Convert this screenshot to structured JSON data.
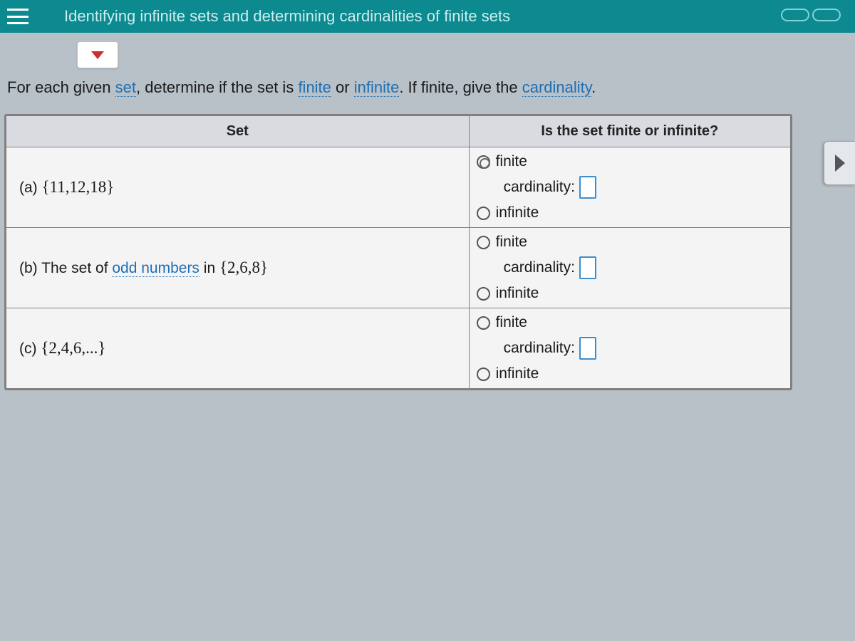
{
  "header": {
    "title": "Identifying infinite sets and determining cardinalities of finite sets"
  },
  "instruction": {
    "prefix": "For each given ",
    "term_set": "set",
    "mid1": ", determine if the set is ",
    "term_finite": "finite",
    "mid2": " or ",
    "term_infinite": "infinite",
    "mid3": ". If finite, give the ",
    "term_cardinality": "cardinality",
    "suffix": "."
  },
  "table": {
    "col1": "Set",
    "col2": "Is the set finite or infinite?",
    "labels": {
      "finite": "finite",
      "infinite": "infinite",
      "cardinality": "cardinality:"
    },
    "rows": [
      {
        "label": "(a)",
        "set_html": "{11,12,18}",
        "cardinality_value": ""
      },
      {
        "label": "(b)",
        "prefix": "The set of ",
        "link": "odd numbers",
        "suffix_in": " in ",
        "set_html": "{2,6,8}",
        "cardinality_value": ""
      },
      {
        "label": "(c)",
        "set_html": "{2,4,6,...}",
        "cardinality_value": ""
      }
    ]
  }
}
